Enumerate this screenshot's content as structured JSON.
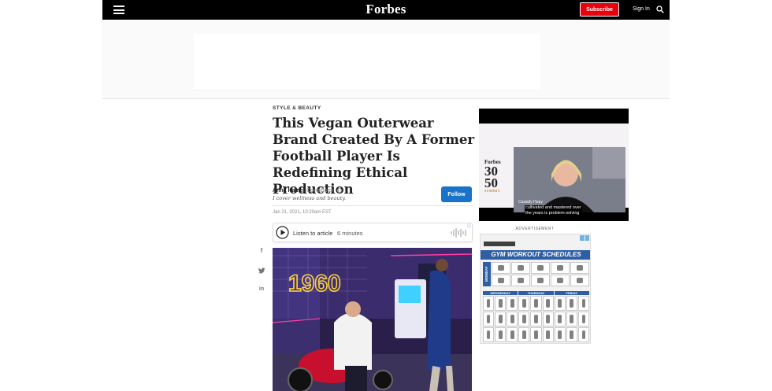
{
  "nav": {
    "logo": "Forbes",
    "subscribe_label": "Subscribe",
    "signin_label": "Sign In"
  },
  "article": {
    "kicker": "STYLE & BEAUTY",
    "headline": "This Vegan Outerwear Brand Created By A Former Football Player Is Redefining Ethical Production",
    "author_name": "Anna Haines",
    "author_role": "Contributor",
    "author_bio": "I cover wellness and beauty.",
    "follow_label": "Follow",
    "date": "Jan 21, 2021, 10:20am EST",
    "audio": {
      "label": "Listen to article",
      "duration": "6 minutes"
    },
    "hero_neon": "1960"
  },
  "share": [
    "facebook-icon",
    "twitter-icon",
    "linkedin-icon"
  ],
  "video": {
    "logo_forbes": "Forbes",
    "logo_number_top": "30",
    "logo_number_bottom": "50",
    "logo_summit": "SUMMIT",
    "caption_name": "Cassidy Huey",
    "subtitle_line1": "cultivated and mastered over",
    "subtitle_line2": "the years is problem-solving"
  },
  "ad": {
    "advertisement_label": "ADVERTISEMENT",
    "gym_title": "GYM WORKOUT SCHEDULES",
    "day_monday": "MONDAY",
    "day_wednesday": "WEDNESDAY",
    "day_thursday": "THURSDAY",
    "day_friday": "FRIDAY"
  },
  "colors": {
    "nav_bg": "#000000",
    "subscribe_bg": "#e8000d",
    "follow_bg": "#1a73c8",
    "gym_blue": "#2e5fa5"
  }
}
